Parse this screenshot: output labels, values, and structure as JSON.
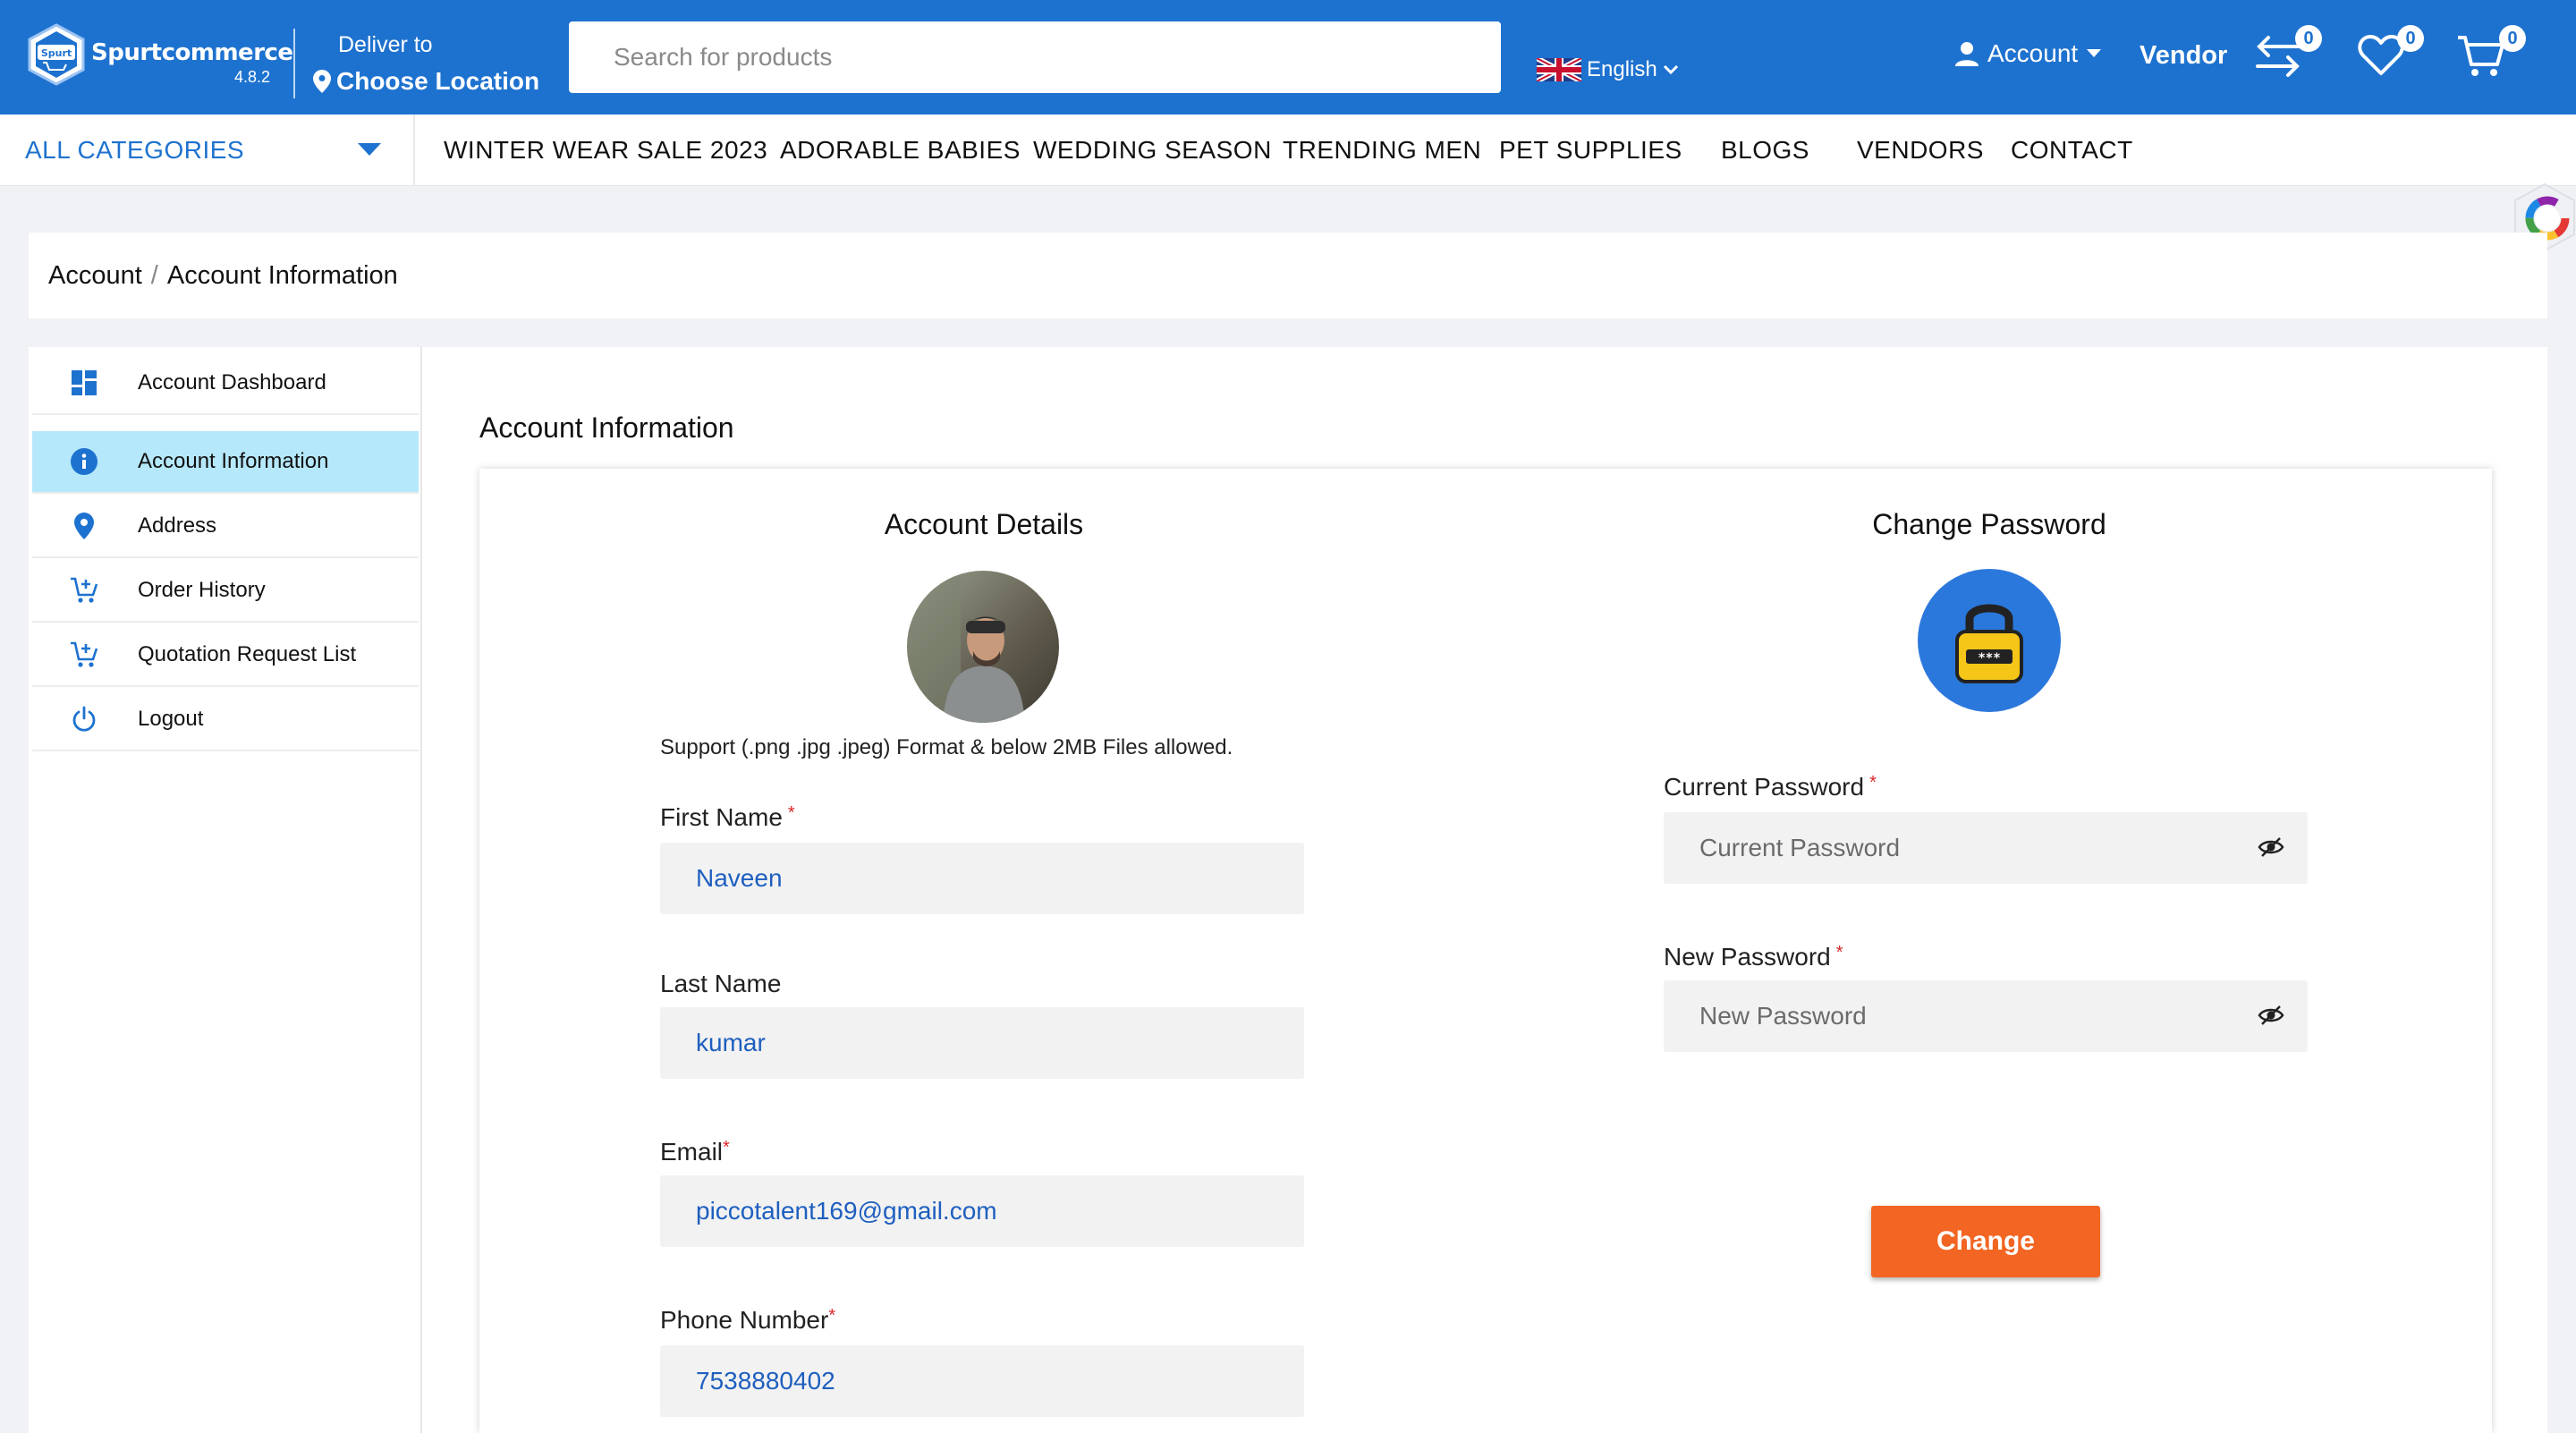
{
  "header": {
    "logo_text": "Spurtcommerce",
    "logo_badge": "Spurt",
    "version": "4.8.2",
    "deliver_to": "Deliver to",
    "location": "Choose Location",
    "search_placeholder": "Search for products",
    "language": "English",
    "account_label": "Account",
    "vendor_label": "Vendor",
    "compare_count": "0",
    "wishlist_count": "0",
    "cart_count": "0"
  },
  "nav": {
    "all_categories": "ALL CATEGORIES",
    "items": [
      "WINTER WEAR SALE 2023",
      "ADORABLE BABIES",
      "WEDDING SEASON",
      "TRENDING MEN",
      "PET SUPPLIES",
      "BLOGS",
      "VENDORS",
      "CONTACT"
    ]
  },
  "breadcrumb": {
    "root": "Account",
    "separator": "/",
    "current": "Account Information"
  },
  "sidebar": {
    "items": [
      {
        "label": "Account Dashboard",
        "icon": "dashboard-icon"
      },
      {
        "label": "Account Information",
        "icon": "info-icon",
        "active": true
      },
      {
        "label": "Address",
        "icon": "location-pin-icon"
      },
      {
        "label": "Order History",
        "icon": "cart-icon"
      },
      {
        "label": "Quotation Request List",
        "icon": "cart-icon"
      },
      {
        "label": "Logout",
        "icon": "power-icon"
      }
    ]
  },
  "main": {
    "title": "Account Information",
    "details": {
      "title": "Account Details",
      "support_text": "Support (.png .jpg .jpeg) Format & below 2MB Files allowed.",
      "first_name_label": "First Name",
      "first_name": "Naveen",
      "last_name_label": "Last Name",
      "last_name": "kumar",
      "email_label": "Email",
      "email": "piccotalent169@gmail.com",
      "phone_label": "Phone Number",
      "phone": "7538880402",
      "required_mark": "*"
    },
    "password": {
      "title": "Change Password",
      "current_label": "Current Password",
      "current_placeholder": "Current Password",
      "new_label": "New Password",
      "new_placeholder": "New Password",
      "submit": "Change"
    }
  },
  "colors": {
    "brand_blue": "#1e72cf",
    "active_item": "#b6e8fb",
    "accent_orange": "#f26522",
    "required_red": "#d9262b"
  }
}
